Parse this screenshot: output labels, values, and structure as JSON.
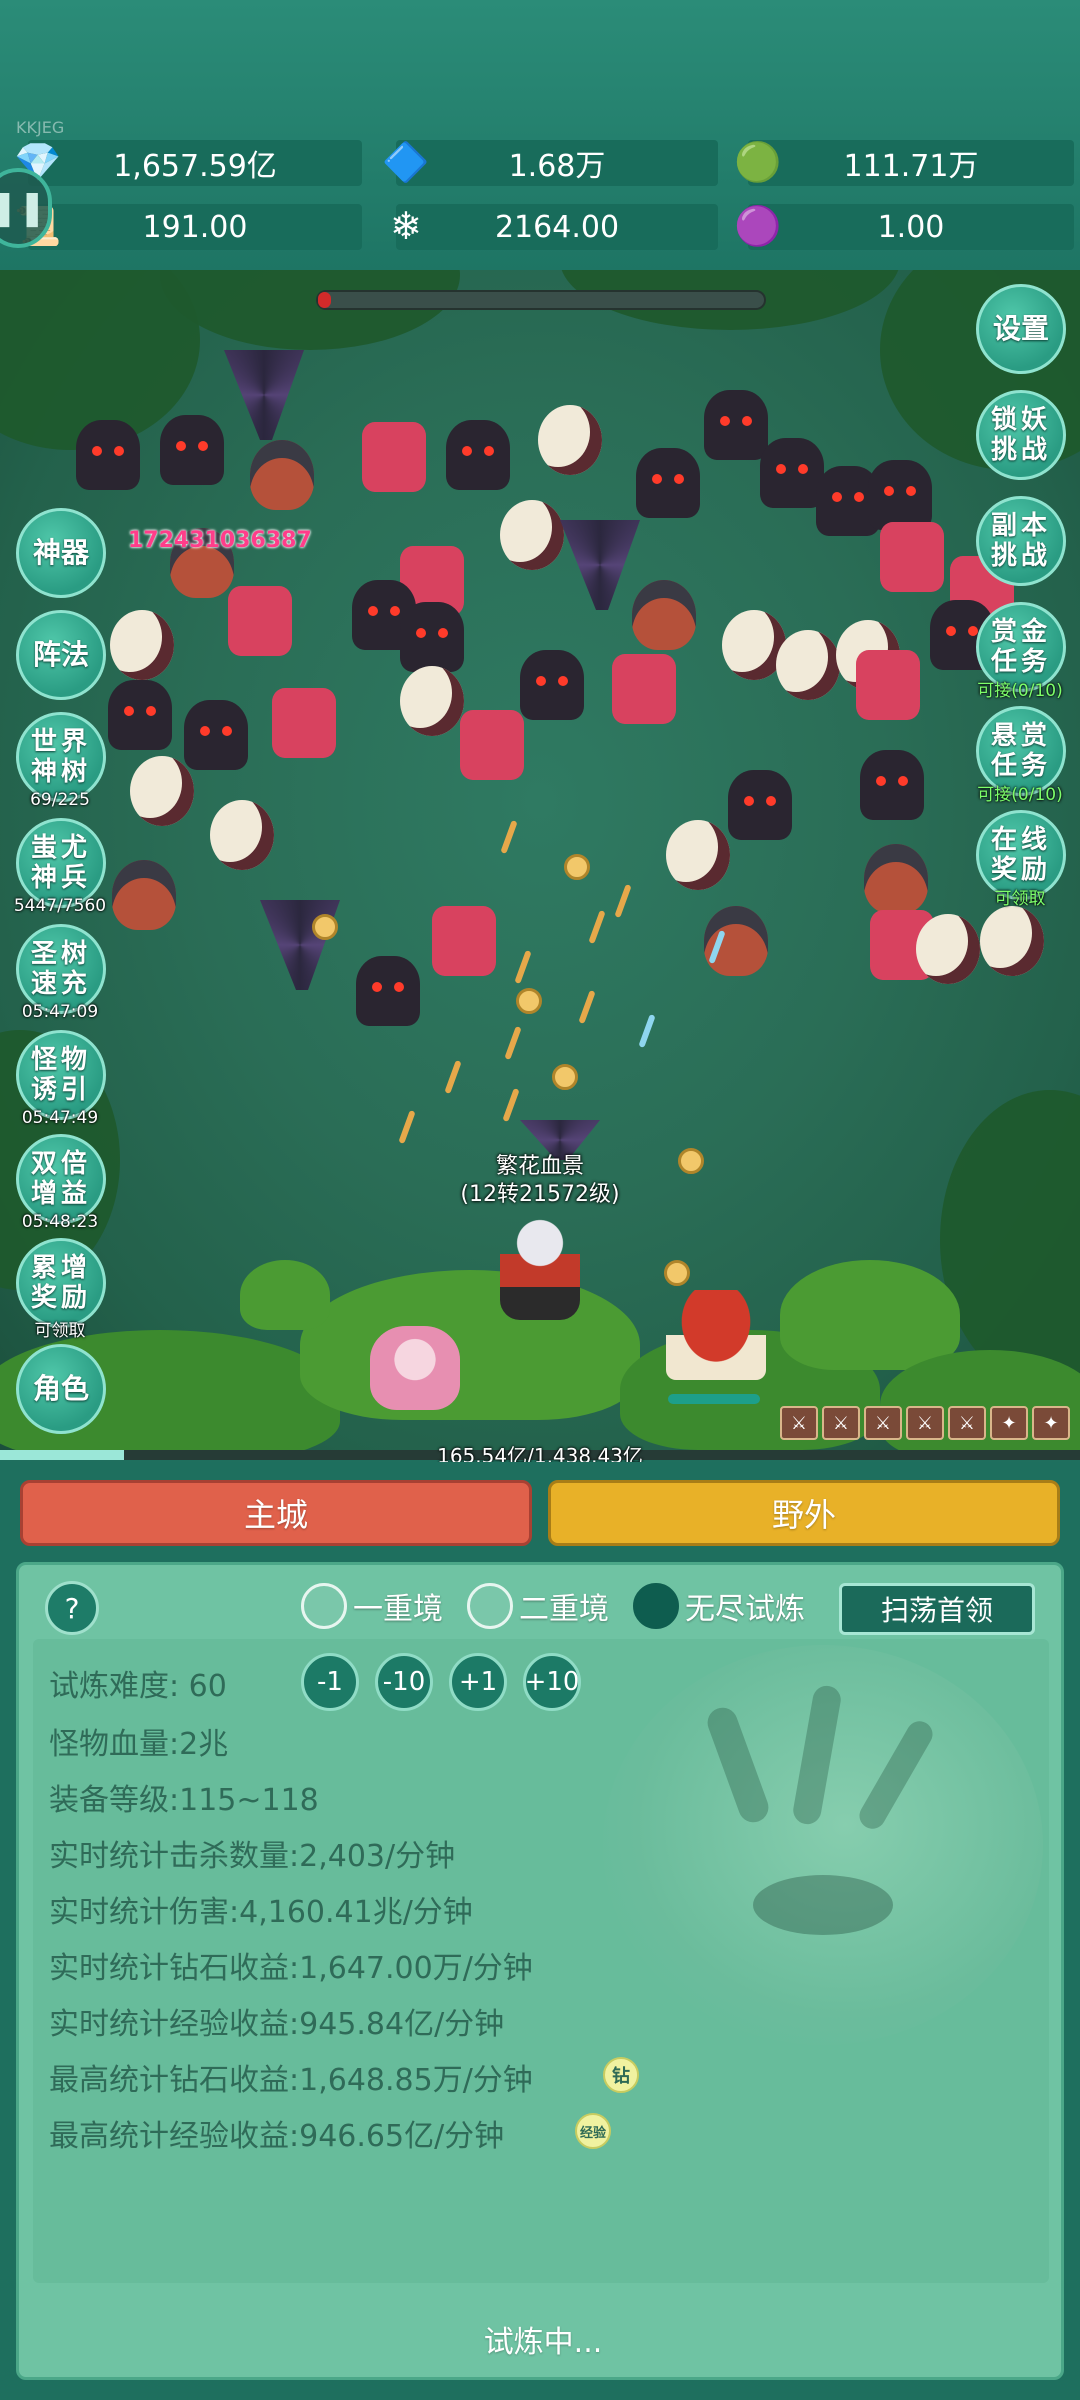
{
  "watermark": "KKJEG",
  "resources": {
    "row1": [
      {
        "icon": "gem-icon",
        "glyph": "💎",
        "value": "1,657.59亿"
      },
      {
        "icon": "blue-crystal-icon",
        "glyph": "🔷",
        "value": "1.68万"
      },
      {
        "icon": "green-orb-icon",
        "glyph": "🟢",
        "value": "111.71万"
      }
    ],
    "row2": [
      {
        "icon": "scroll-icon",
        "glyph": "📜",
        "value": "191.00"
      },
      {
        "icon": "ice-crystal-icon",
        "glyph": "❄",
        "value": "2164.00"
      },
      {
        "icon": "purple-bag-icon",
        "glyph": "🟣",
        "value": "1.00"
      }
    ]
  },
  "battle": {
    "damage_number": "172431036387",
    "player_name": "繁花血景",
    "player_level": "(12转21572级)",
    "exp_text": "165.54亿/1,438.43亿",
    "exp_fraction": 0.115,
    "boss_hp_fraction": 0.03
  },
  "left_buttons": [
    {
      "label": "神器",
      "sub": ""
    },
    {
      "label": "阵法",
      "sub": ""
    },
    {
      "label": "世界神树",
      "sub": "69/225"
    },
    {
      "label": "蚩尤神兵",
      "sub": "5447/7560"
    },
    {
      "label": "圣树速充",
      "sub": "05:47:09"
    },
    {
      "label": "怪物诱引",
      "sub": "05:47:49"
    },
    {
      "label": "双倍增益",
      "sub": "05:48:23"
    },
    {
      "label": "累增奖励",
      "sub": "可领取"
    },
    {
      "label": "角色",
      "sub": ""
    }
  ],
  "right_buttons": [
    {
      "label": "设置",
      "sub": ""
    },
    {
      "label": "锁妖挑战",
      "sub": ""
    },
    {
      "label": "副本挑战",
      "sub": ""
    },
    {
      "label": "赏金任务",
      "sub": "可接(0/10)"
    },
    {
      "label": "悬赏任务",
      "sub": "可接(0/10)"
    },
    {
      "label": "在线奖励",
      "sub": "可领取"
    }
  ],
  "tabs": {
    "city": "主城",
    "wild": "野外"
  },
  "panel": {
    "help": "?",
    "modes": [
      "一重境",
      "二重境",
      "无尽试炼"
    ],
    "selected_mode": "无尽试炼",
    "sweep_button": "扫荡首领",
    "difficulty_label": "试炼难度:",
    "difficulty_value": "60",
    "steps": [
      "-1",
      "-10",
      "+1",
      "+10"
    ],
    "stats": [
      {
        "label": "怪物血量:",
        "value": "2兆"
      },
      {
        "label": "装备等级:",
        "value": "115~118"
      },
      {
        "label": "实时统计击杀数量:",
        "value": "2,403/分钟"
      },
      {
        "label": "实时统计伤害:",
        "value": "4,160.41兆/分钟"
      },
      {
        "label": "实时统计钻石收益:",
        "value": "1,647.00万/分钟"
      },
      {
        "label": "实时统计经验收益:",
        "value": "945.84亿/分钟"
      },
      {
        "label": "最高统计钻石收益:",
        "value": "1,648.85万/分钟"
      },
      {
        "label": "最高统计经验收益:",
        "value": "946.65亿/分钟"
      }
    ],
    "badge_diamond": "钻",
    "badge_exp": "经验",
    "status": "试炼中..."
  },
  "colors": {
    "city_tab": "#e0614b",
    "wild_tab": "#e8b128",
    "panel_bg": "#6fc3a3",
    "damage": "#ff3d8a"
  }
}
